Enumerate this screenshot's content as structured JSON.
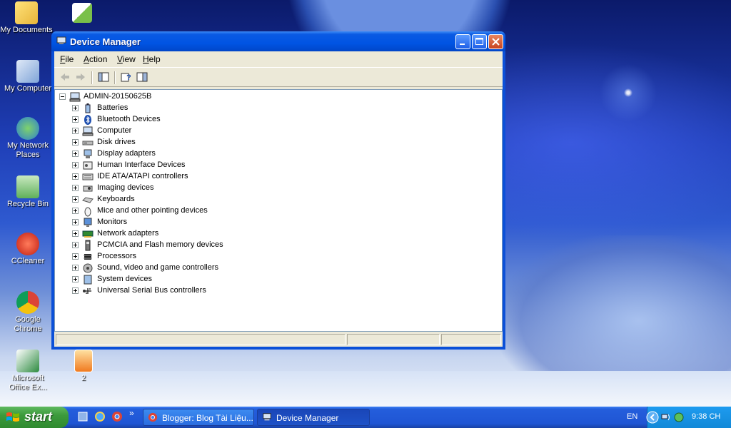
{
  "desktop": {
    "icons": [
      {
        "label": "My Documents"
      },
      {
        "label": "My Computer"
      },
      {
        "label": "My Network Places"
      },
      {
        "label": "Recycle Bin"
      },
      {
        "label": "CCleaner"
      },
      {
        "label": "Google Chrome"
      },
      {
        "label": "Microsoft Office Ex..."
      },
      {
        "label": "2"
      }
    ]
  },
  "window": {
    "title": "Device Manager",
    "menus": [
      {
        "label": "File",
        "accel": "F",
        "rest": "ile"
      },
      {
        "label": "Action",
        "accel": "A",
        "rest": "ction"
      },
      {
        "label": "View",
        "accel": "V",
        "rest": "iew"
      },
      {
        "label": "Help",
        "accel": "H",
        "rest": "elp"
      }
    ],
    "toolbar": [
      "back-icon",
      "forward-icon",
      "show-hide-tree-icon",
      "properties-help-icon",
      "update-driver-icon"
    ],
    "tree": {
      "root": "ADMIN-20150625B",
      "items": [
        "Batteries",
        "Bluetooth Devices",
        "Computer",
        "Disk drives",
        "Display adapters",
        "Human Interface Devices",
        "IDE ATA/ATAPI controllers",
        "Imaging devices",
        "Keyboards",
        "Mice and other pointing devices",
        "Monitors",
        "Network adapters",
        "PCMCIA and Flash memory devices",
        "Processors",
        "Sound, video and game controllers",
        "System devices",
        "Universal Serial Bus controllers"
      ]
    }
  },
  "taskbar": {
    "start": "start",
    "tasks": [
      {
        "label": "Blogger: Blog Tài Liệu..."
      },
      {
        "label": "Device Manager"
      }
    ],
    "lang": "EN",
    "clock": "9:38 CH"
  },
  "colors": {
    "titlebar": "#0054e3",
    "start": "#3c9a3c",
    "tray": "#1289d8"
  }
}
